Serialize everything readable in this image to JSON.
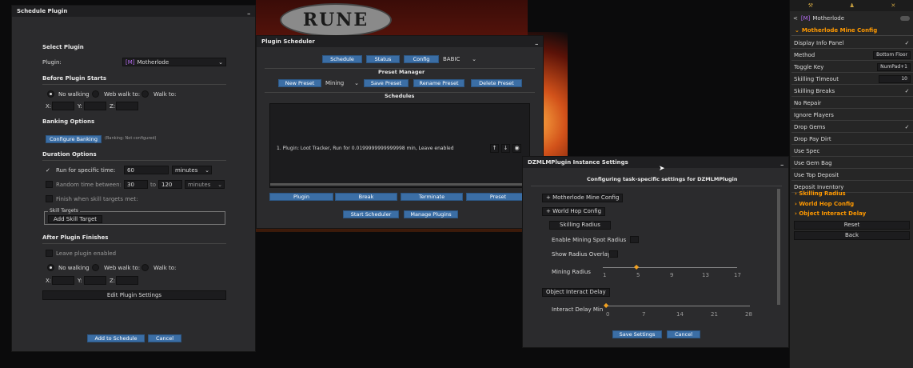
{
  "logo_text": "RUNE",
  "schedule_plugin": {
    "title": "Schedule Plugin",
    "minimize": "_",
    "select_plugin": "Select Plugin",
    "plugin_label": "Plugin:",
    "plugin_value": "Motherlode",
    "plugin_badge": "[M]",
    "before_starts": "Before Plugin Starts",
    "no_walking": "No walking",
    "web_walk_to": "Web walk to:",
    "walk_to": "Walk to:",
    "x": "X:",
    "y": "Y:",
    "z": "Z:",
    "banking_options": "Banking Options",
    "configure_banking": "Configure Banking",
    "banking_status": "(Banking: Not configured)",
    "duration_options": "Duration Options",
    "run_specific_time": "Run for specific time:",
    "run_time_value": "60",
    "minutes": "minutes",
    "random_time_between": "Random time between:",
    "random_min": "30",
    "random_to": "to",
    "random_max": "120",
    "random_unit": "minutes",
    "finish_skill": "Finish when skill targets met:",
    "skill_targets_label": "Skill Targets",
    "add_skill_target": "Add Skill Target",
    "after_finishes": "After Plugin Finishes",
    "leave_enabled": "Leave plugin enabled",
    "edit_settings": "Edit Plugin Settings",
    "add_to_schedule": "Add to Schedule",
    "cancel": "Cancel"
  },
  "plugin_scheduler": {
    "title": "Plugin Scheduler",
    "minimize": "_",
    "tabs": [
      "Schedule",
      "Status",
      "Config"
    ],
    "tab_select": "BABIC",
    "preset_manager": "Preset Manager",
    "new_preset": "New Preset",
    "preset_select": "Mining",
    "save_preset": "Save Preset",
    "rename_preset": "Rename Preset",
    "delete_preset": "Delete Preset",
    "schedules": "Schedules",
    "schedule_item": "1. Plugin: Loot Tracker, Run for 0.0199999999999998 min, Leave enabled",
    "item_up": "↑",
    "item_down": "↓",
    "item_eye": "◉",
    "bottom_tabs": [
      "Plugin",
      "Break",
      "Terminate",
      "Preset"
    ],
    "start_scheduler": "Start Scheduler",
    "manage_plugins": "Manage Plugins"
  },
  "instance_settings": {
    "title": "DZMLMPlugin Instance Settings",
    "minimize": "_",
    "subtitle": "Configuring task-specific settings for DZMLMPlugin",
    "sections": [
      {
        "label": "+ Motherlode Mine Config"
      },
      {
        "label": "+ World Hop Config"
      },
      {
        "label": "Skilling Radius"
      }
    ],
    "enable_radius": "Enable Mining Spot Radius",
    "show_overlay": "Show Radius Overlay",
    "mining_radius": "Mining Radius",
    "radius_ticks": [
      "1",
      "5",
      "9",
      "13",
      "17"
    ],
    "mining_radius_value": 5,
    "radius_min": 1,
    "radius_max": 17,
    "object_delay": "Object Interact Delay",
    "interact_delay_min": "Interact Delay Min",
    "delay_ticks": [
      "0",
      "7",
      "14",
      "21",
      "28"
    ],
    "delay_value": 0,
    "delay_min": 0,
    "delay_max": 28,
    "save_settings": "Save Settings",
    "cancel": "Cancel"
  },
  "right_panel": {
    "back_title": "Motherlode",
    "back_arrow": "<",
    "section_title": "Motherlode Mine Config",
    "rows": [
      {
        "label": "Display Info Panel",
        "checked": true
      },
      {
        "label": "Method",
        "value": "Bottom Floor"
      },
      {
        "label": "Toggle Key",
        "value": "NumPad+1"
      },
      {
        "label": "Skilling Timeout",
        "value": "10"
      },
      {
        "label": "Skilling Breaks",
        "checked": true
      },
      {
        "label": "No Repair",
        "checked": false
      },
      {
        "label": "Ignore Players",
        "checked": false
      },
      {
        "label": "Drop Gems",
        "checked": true
      },
      {
        "label": "Drop Pay Dirt",
        "checked": false
      },
      {
        "label": "Use Spec",
        "checked": false
      },
      {
        "label": "Use Gem Bag",
        "checked": false
      },
      {
        "label": "Use Top Deposit",
        "checked": false
      },
      {
        "label": "Deposit Inventory",
        "checked": false
      }
    ],
    "sub_sections": [
      "Skilling Radius",
      "World Hop Config",
      "Object Interact Delay"
    ],
    "reset": "Reset",
    "back": "Back",
    "accent_color": "#ff9900"
  }
}
